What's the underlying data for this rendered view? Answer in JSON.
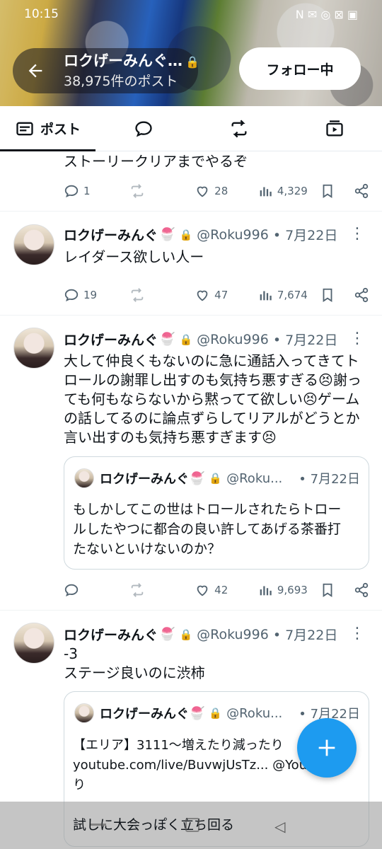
{
  "status": {
    "time": "10:15",
    "icons": "N ✉ ◎ ⊠ ▣"
  },
  "header": {
    "name": "ロクげーみんぐ…",
    "post_count": "38,975件のポスト",
    "follow_label": "フォロー中"
  },
  "tabs": [
    {
      "label": "ポスト",
      "icon": "posts-icon"
    },
    {
      "label": "",
      "icon": "replies-icon"
    },
    {
      "label": "",
      "icon": "reposts-icon"
    },
    {
      "label": "",
      "icon": "media-icon"
    }
  ],
  "posts": [
    {
      "text": "ストーリークリアまでやるぞ",
      "replies": "1",
      "reposts": "",
      "likes": "28",
      "views": "4,329"
    },
    {
      "name": "ロクげーみんぐ",
      "emoji": "🍧",
      "handle": "@Roku996",
      "date": "• 7月22日",
      "text": "レイダース欲しい人ー",
      "replies": "19",
      "reposts": "",
      "likes": "47",
      "views": "7,674"
    },
    {
      "name": "ロクげーみんぐ",
      "emoji": "🍧",
      "handle": "@Roku996",
      "date": "• 7月22日",
      "lines": [
        "大して仲良くもないのに急に通話入ってきてト",
        "ロールの謝罪し出すのも気持ち悪すぎる😣謝っ",
        "ても何もならないから黙ってて欲しい😣ゲーム",
        "の話してるのに論点ずらしてリアルがどうとか",
        "言い出すのも気持ち悪すぎます😣"
      ],
      "quote": {
        "name": "ロクげーみんぐ",
        "emoji": "🍧",
        "handle": "@Roku...",
        "date": "• 7月22日",
        "lines": [
          "もしかしてこの世はトロールされたらトロー",
          "ルしたやつに都合の良い許してあげる茶番打",
          "たないといけないのか？"
        ]
      },
      "replies": "",
      "reposts": "",
      "likes": "42",
      "views": "9,693"
    },
    {
      "name": "ロクげーみんぐ",
      "emoji": "🍧",
      "handle": "@Roku996",
      "date": "• 7月22日",
      "lines": [
        "-3",
        "ステージ良いのに渋柿"
      ],
      "quote": {
        "name": "ロクげーみんぐ",
        "emoji": "🍧",
        "handle": "@Roku...",
        "date": "• 7月22日",
        "lines": [
          "【エリア】3111〜増えたり減ったり",
          "youtube.com/live/BuvwjUsTz... @YouTubeより"
        ]
      }
    }
  ],
  "overlay_text": "試しに大会っぽく立ち回る",
  "colors": {
    "accent": "#1d9bf0",
    "muted": "#536471",
    "text": "#0f1419"
  }
}
